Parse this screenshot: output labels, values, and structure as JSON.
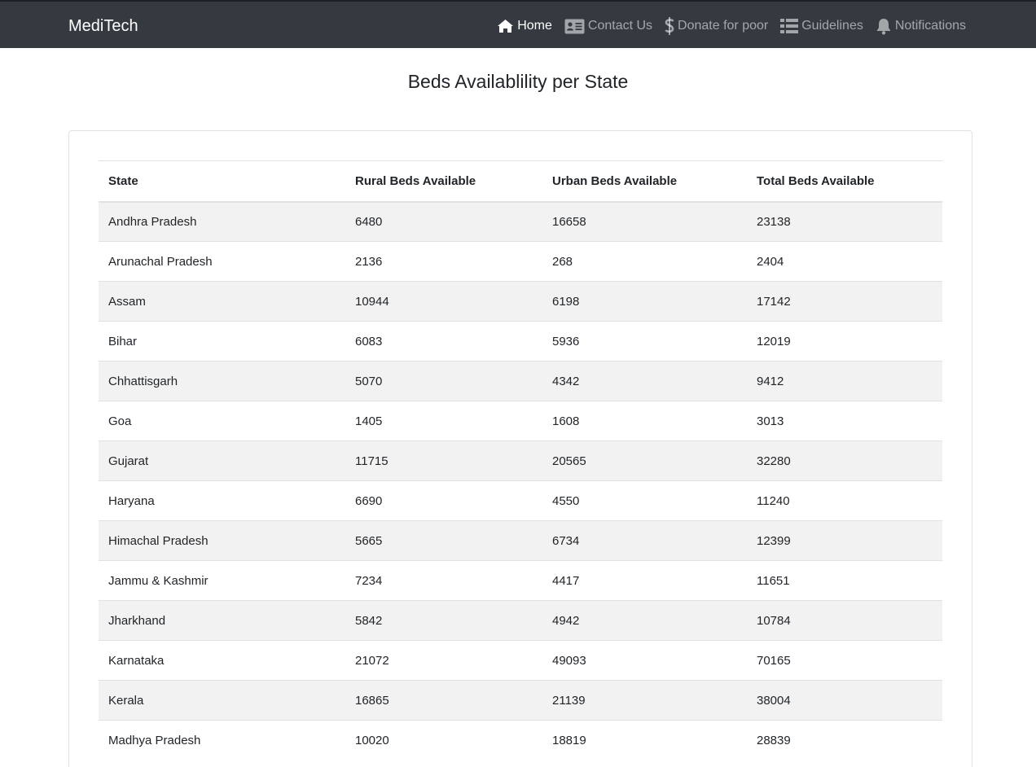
{
  "navbar": {
    "brand": "MediTech",
    "items": [
      {
        "label": "Home",
        "icon": "home-icon",
        "active": true
      },
      {
        "label": "Contact Us",
        "icon": "address-card-icon",
        "active": false
      },
      {
        "label": "Donate for poor",
        "icon": "dollar-icon",
        "active": false
      },
      {
        "label": "Guidelines",
        "icon": "list-icon",
        "active": false
      },
      {
        "label": "Notifications",
        "icon": "bell-icon",
        "active": false
      }
    ]
  },
  "page": {
    "title": "Beds Availablility per State"
  },
  "table": {
    "headers": [
      "State",
      "Rural Beds Available",
      "Urban Beds Available",
      "Total Beds Available"
    ],
    "rows": [
      [
        "Andhra Pradesh",
        "6480",
        "16658",
        "23138"
      ],
      [
        "Arunachal Pradesh",
        "2136",
        "268",
        "2404"
      ],
      [
        "Assam",
        "10944",
        "6198",
        "17142"
      ],
      [
        "Bihar",
        "6083",
        "5936",
        "12019"
      ],
      [
        "Chhattisgarh",
        "5070",
        "4342",
        "9412"
      ],
      [
        "Goa",
        "1405",
        "1608",
        "3013"
      ],
      [
        "Gujarat",
        "11715",
        "20565",
        "32280"
      ],
      [
        "Haryana",
        "6690",
        "4550",
        "11240"
      ],
      [
        "Himachal Pradesh",
        "5665",
        "6734",
        "12399"
      ],
      [
        "Jammu & Kashmir",
        "7234",
        "4417",
        "11651"
      ],
      [
        "Jharkhand",
        "5842",
        "4942",
        "10784"
      ],
      [
        "Karnataka",
        "21072",
        "49093",
        "70165"
      ],
      [
        "Kerala",
        "16865",
        "21139",
        "38004"
      ],
      [
        "Madhya Pradesh",
        "10020",
        "18819",
        "28839"
      ]
    ]
  }
}
